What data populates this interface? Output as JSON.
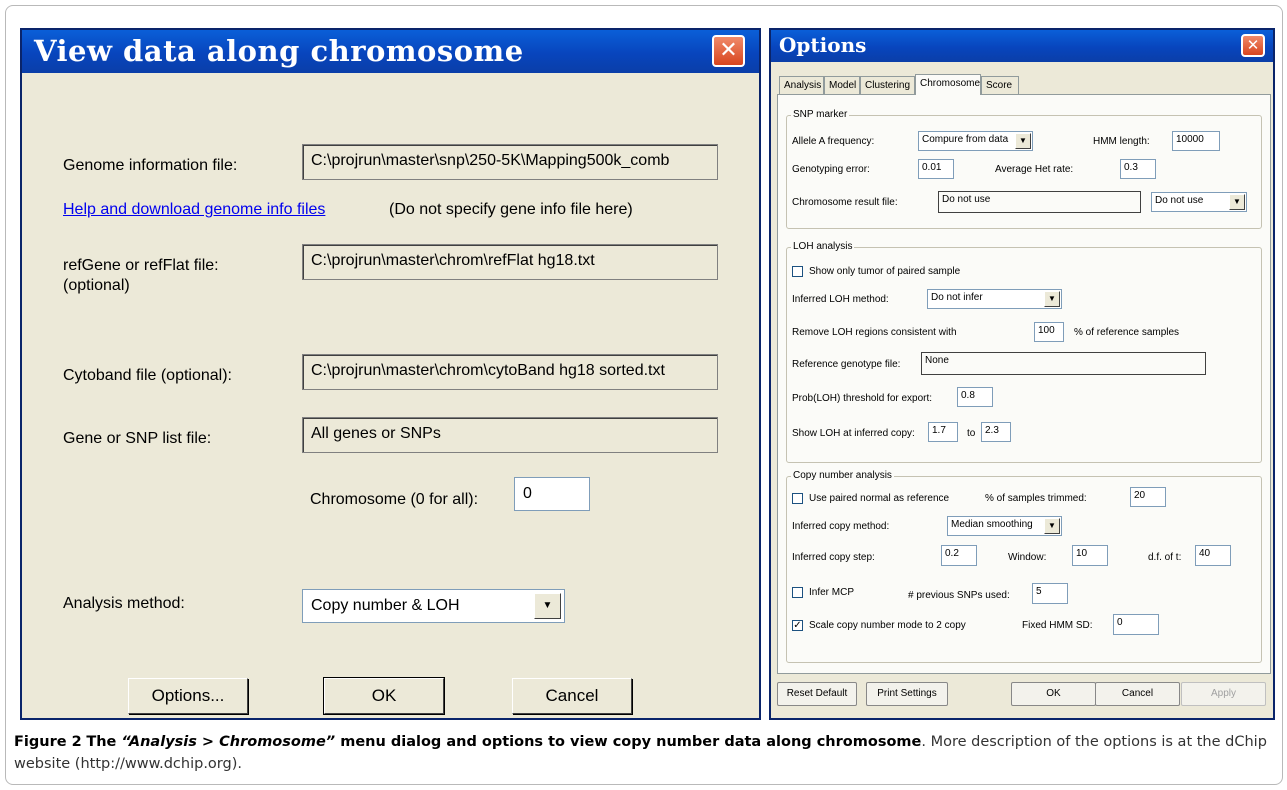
{
  "left_dialog": {
    "title": "View data along chromosome",
    "close_glyph": "✕",
    "genome_label": "Genome information file:",
    "genome_value": "C:\\projrun\\master\\snp\\250-5K\\Mapping500k_comb",
    "help_link": "Help and download genome info files",
    "help_note": "(Do not specify gene info file here)",
    "refgene_label": "refGene or refFlat file:",
    "refgene_optional": "(optional)",
    "refgene_value": "C:\\projrun\\master\\chrom\\refFlat hg18.txt",
    "cytoband_label": "Cytoband file (optional):",
    "cytoband_value": "C:\\projrun\\master\\chrom\\cytoBand hg18 sorted.txt",
    "genelist_label": "Gene or SNP list file:",
    "genelist_value": "All genes or SNPs",
    "chromosome_label": "Chromosome (0 for all):",
    "chromosome_value": "0",
    "analysis_label": "Analysis method:",
    "analysis_value": "Copy number & LOH",
    "options_button": "Options...",
    "ok_button": "OK",
    "cancel_button": "Cancel"
  },
  "right_dialog": {
    "title": "Options",
    "close_glyph": "✕",
    "tabs": [
      "Analysis",
      "Model",
      "Clustering",
      "Chromosome",
      "Score"
    ],
    "active_tab": "Chromosome",
    "snp_marker": {
      "legend": "SNP marker",
      "allele_label": "Allele A frequency:",
      "allele_value": "Compure from data",
      "hmm_length_label": "HMM length:",
      "hmm_length_value": "10000",
      "genotyping_error_label": "Genotyping error:",
      "genotyping_error_value": "0.01",
      "avg_het_label": "Average Het rate:",
      "avg_het_value": "0.3",
      "chrom_result_label": "Chromosome result file:",
      "chrom_result_value": "Do not use",
      "chrom_result_select": "Do not use"
    },
    "loh": {
      "legend": "LOH analysis",
      "show_tumor_label": "Show only tumor of paired sample",
      "show_tumor_checked": false,
      "inferred_method_label": "Inferred LOH method:",
      "inferred_method_value": "Do not infer",
      "remove_label": "Remove LOH regions consistent with",
      "remove_value": "100",
      "remove_suffix": "% of reference samples",
      "ref_genotype_label": "Reference genotype file:",
      "ref_genotype_value": "None",
      "prob_label": "Prob(LOH) threshold for export:",
      "prob_value": "0.8",
      "show_loh_label": "Show LOH at inferred copy:",
      "show_loh_from": "1.7",
      "show_loh_to_label": "to",
      "show_loh_to": "2.3"
    },
    "copy_number": {
      "legend": "Copy number analysis",
      "use_paired_label": "Use paired normal as reference",
      "use_paired_checked": false,
      "trimmed_label": "% of samples trimmed:",
      "trimmed_value": "20",
      "inferred_method_label": "Inferred copy method:",
      "inferred_method_value": "Median smoothing",
      "step_label": "Inferred copy step:",
      "step_value": "0.2",
      "window_label": "Window:",
      "window_value": "10",
      "df_label": "d.f. of t:",
      "df_value": "40",
      "infer_mcp_label": "Infer MCP",
      "infer_mcp_checked": false,
      "prev_snps_label": "# previous SNPs used:",
      "prev_snps_value": "5",
      "scale_label": "Scale copy number mode to 2 copy",
      "scale_checked": true,
      "fixed_sd_label": "Fixed HMM SD:",
      "fixed_sd_value": "0"
    },
    "buttons": {
      "reset": "Reset Default",
      "print": "Print Settings",
      "ok": "OK",
      "cancel": "Cancel",
      "apply": "Apply"
    }
  },
  "caption": {
    "figure_label": "Figure 2",
    "title_pre": "The ",
    "title_italic": "“Analysis > Chromosome”",
    "title_post": " menu dialog and options to view copy number data along chromosome",
    "body": ". More description of the options is at the dChip website (http://www.dchip.org)."
  },
  "icons": {
    "dropdown": "▼",
    "checkmark": "✓"
  }
}
